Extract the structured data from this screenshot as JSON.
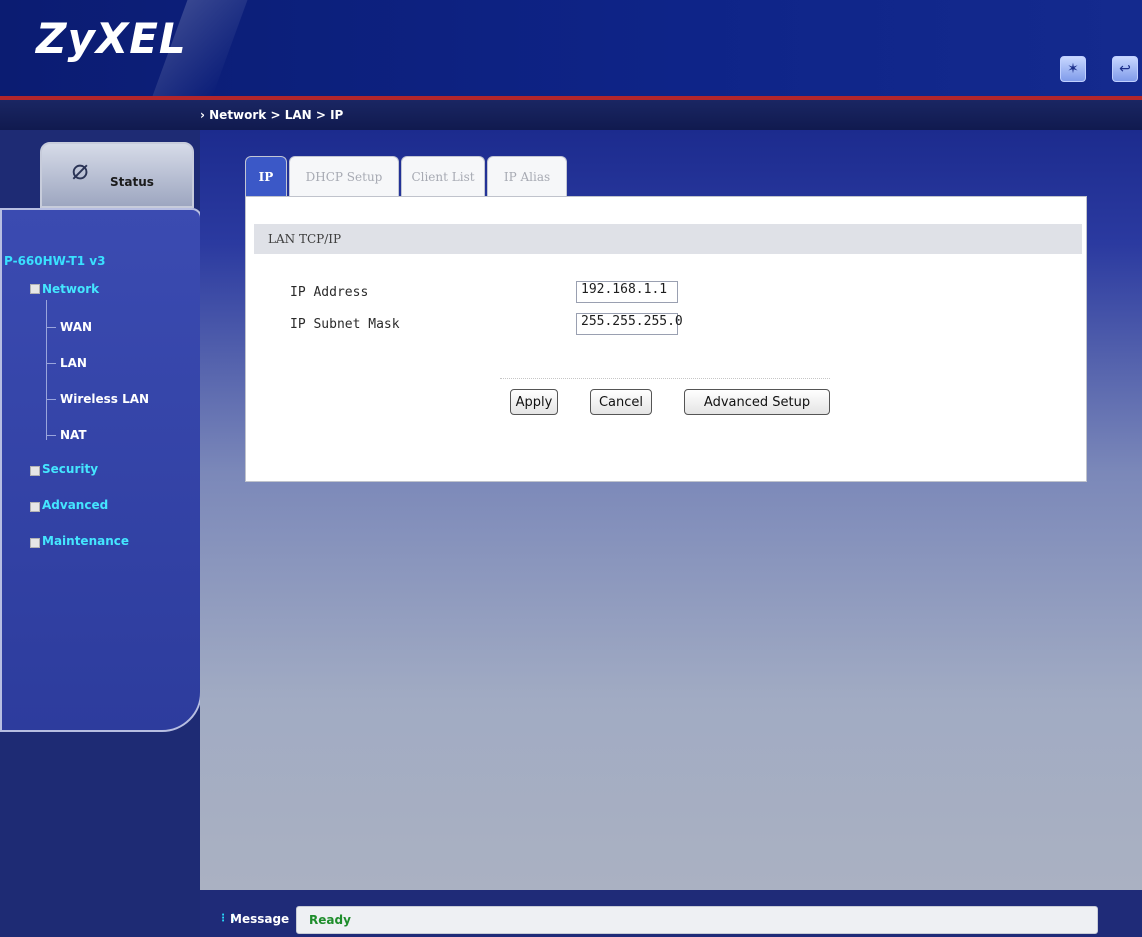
{
  "header": {
    "logo": "ZyXEL",
    "icons": [
      "wizard-icon",
      "logout-icon"
    ]
  },
  "breadcrumb": "Network > LAN > IP",
  "left": {
    "status_label": "Status",
    "model": "P-660HW-T1 v3",
    "nav": {
      "network": "Network",
      "wan": "WAN",
      "lan": "LAN",
      "wireless_lan": "Wireless LAN",
      "nat": "NAT",
      "security": "Security",
      "advanced": "Advanced",
      "maintenance": "Maintenance"
    }
  },
  "tabs": [
    {
      "label": "IP",
      "active": true
    },
    {
      "label": "DHCP Setup",
      "active": false
    },
    {
      "label": "Client List",
      "active": false
    },
    {
      "label": "IP Alias",
      "active": false
    }
  ],
  "section": {
    "title": "LAN TCP/IP",
    "ip_address_label": "IP Address",
    "ip_address_value": "192.168.1.1",
    "subnet_mask_label": "IP Subnet Mask",
    "subnet_mask_value": "255.255.255.0"
  },
  "buttons": {
    "apply": "Apply",
    "cancel": "Cancel",
    "advanced_setup": "Advanced Setup"
  },
  "message": {
    "label": "Message",
    "text": "Ready"
  },
  "colors": {
    "header": "#0e2488",
    "accent_red": "#b3262b",
    "active_tab": "#3b58c7",
    "nav_group": "#44e6ff",
    "status_ready": "#1e8d2b"
  }
}
